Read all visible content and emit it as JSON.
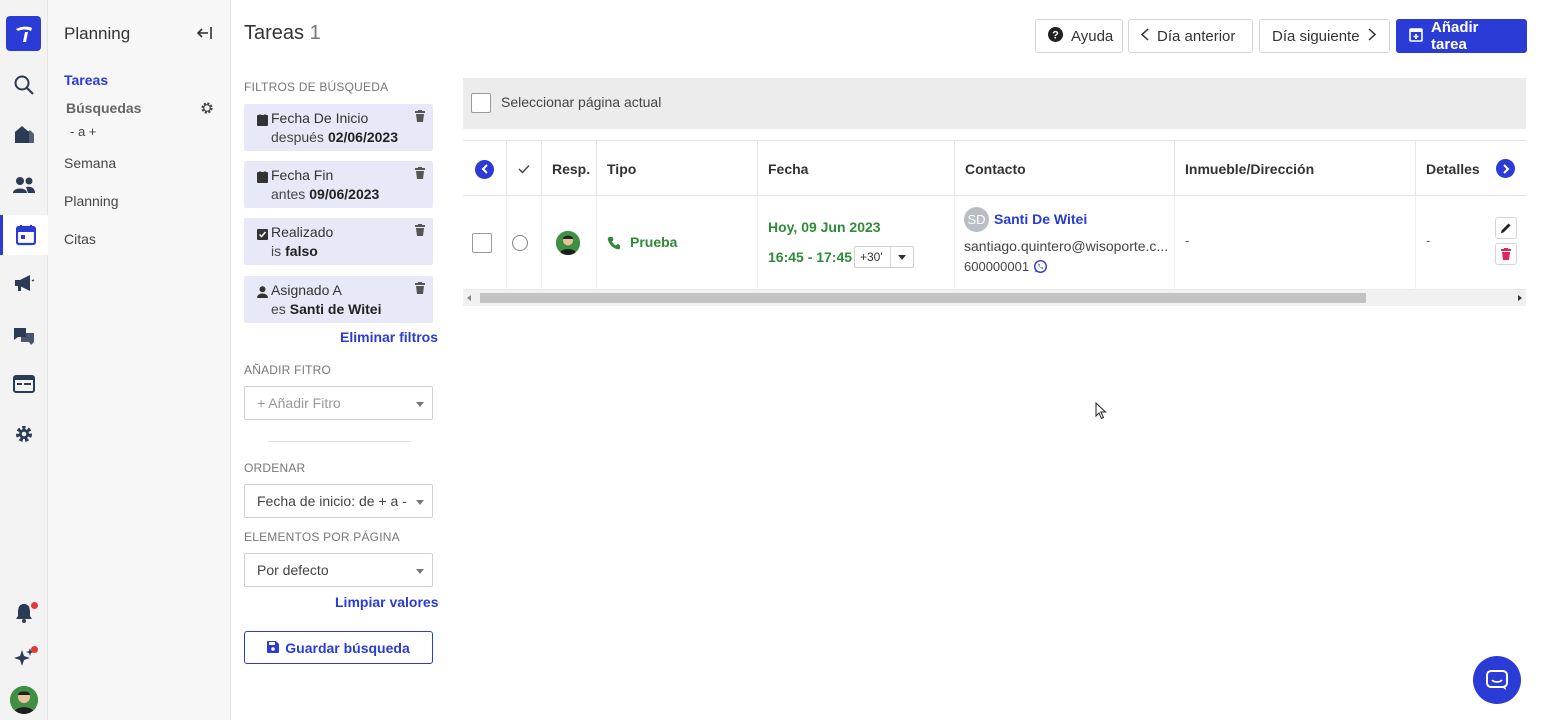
{
  "app": {
    "brand_color": "#2a3bd6"
  },
  "rail": {
    "icons": [
      "logo-icon",
      "search-icon",
      "properties-icon",
      "contacts-icon",
      "calendar-icon",
      "megaphone-icon",
      "chat-icon",
      "portals-icon",
      "settings-icon",
      "notifications-icon",
      "news-icon",
      "user-avatar"
    ],
    "active": "calendar-icon"
  },
  "sidebar": {
    "title": "Planning",
    "items": {
      "tareas": "Tareas",
      "busquedas": "Búsquedas",
      "busquedas_sub": "- a +",
      "semana": "Semana",
      "planning": "Planning",
      "citas": "Citas"
    }
  },
  "page": {
    "title": "Tareas",
    "count": "1"
  },
  "filters": {
    "header": "FILTROS DE BÚSQUEDA",
    "chips": [
      {
        "field": "Fecha De Inicio",
        "op": "después",
        "value": "02/06/2023",
        "icon": "calendar-icon"
      },
      {
        "field": "Fecha Fin",
        "op": "antes",
        "value": "09/06/2023",
        "icon": "calendar-icon"
      },
      {
        "field": "Realizado",
        "op": "is",
        "value": "falso",
        "icon": "checkbox-icon"
      },
      {
        "field": "Asignado A",
        "op": "es",
        "value": "Santi de Witei",
        "icon": "user-icon"
      }
    ],
    "clear_link": "Eliminar filtros",
    "add_header": "AÑADIR FITRO",
    "add_placeholder": "+ Añadir Fitro",
    "order_header": "ORDENAR",
    "order_value": "Fecha de inicio: de + a -",
    "per_page_header": "ELEMENTOS POR PÁGINA",
    "per_page_value": "Por defecto",
    "reset_link": "Limpiar valores",
    "save_button": "Guardar búsqueda"
  },
  "toolbar": {
    "help": "Ayuda",
    "prev_day": "Día anterior",
    "next_day": "Día siguiente",
    "add_task": "Añadir tarea"
  },
  "selection": {
    "label": "Seleccionar página actual"
  },
  "table": {
    "columns": [
      "Resp.",
      "Tipo",
      "Fecha",
      "Contacto",
      "Inmueble/Dirección",
      "Detalles"
    ],
    "rows": [
      {
        "type": "Prueba",
        "date": "Hoy, 09 Jun 2023",
        "time": "16:45 - 17:45",
        "duration": "+30'",
        "contact_initials": "SD",
        "contact_name": "Santi De Witei",
        "contact_email": "santiago.quintero@wisoporte.c...",
        "contact_phone": "600000001",
        "property": "-",
        "details": "-"
      }
    ]
  }
}
